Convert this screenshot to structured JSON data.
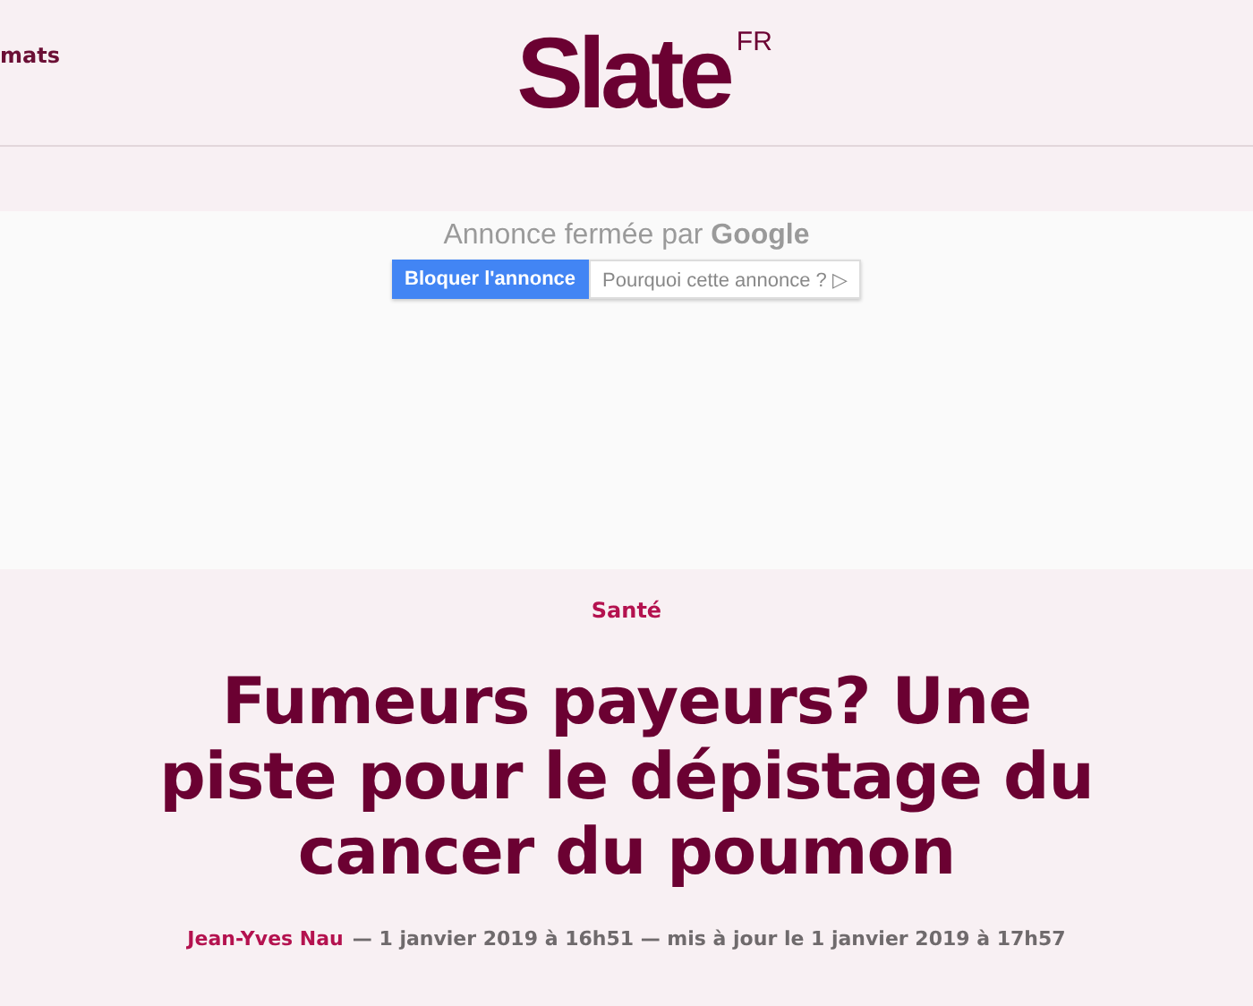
{
  "header": {
    "nav_label": "mats",
    "logo": "Slate",
    "logo_edition": "FR"
  },
  "ad": {
    "message": "Annonce fermée par **Google**",
    "buttons": [
      {
        "label": "Bloquer l'annonce",
        "kind": "primary"
      },
      {
        "label": "Pourquoi cette annonce ?",
        "kind": "secondary",
        "icon": "▷"
      }
    ]
  },
  "article": {
    "category": "Santé",
    "title": "Fumeurs payeurs? Une piste pour le dépistage du cancer du poumon",
    "author": "Jean-Yves Nau",
    "date": "— 1 janvier 2019 à 16h51 — mis à jour le 1 janvier 2019 à 17h57"
  }
}
